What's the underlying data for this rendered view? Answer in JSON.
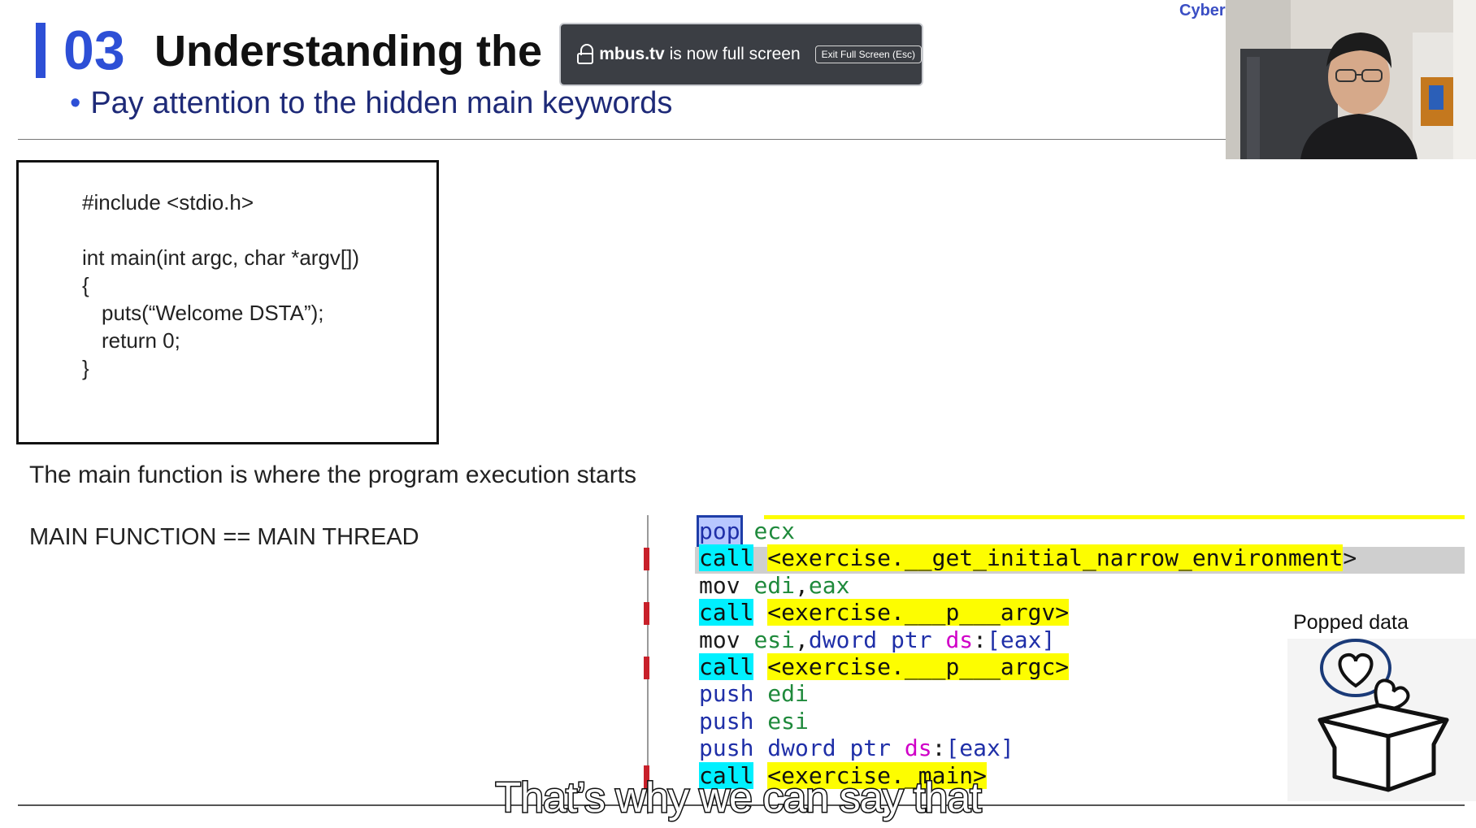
{
  "slide": {
    "number": "03",
    "title": "Understanding the",
    "subtitle": "Pay attention to the hidden main keywords",
    "brand": "Cyber"
  },
  "fullscreen_notice": {
    "domain": "mbus.tv",
    "message": " is now full screen",
    "exit_label": "Exit Full Screen (Esc)"
  },
  "code_box": {
    "lines": [
      "#include <stdio.h>",
      "int main(int argc, char *argv[])",
      "{",
      "puts(“Welcome DSTA”);",
      "return 0;",
      "}"
    ]
  },
  "description": "The main function is where the program  execution starts",
  "main_equivalence": "MAIN FUNCTION  == MAIN THREAD",
  "disassembly": {
    "lines": [
      {
        "op": "pop",
        "args": [
          {
            "t": "reg",
            "v": "ecx"
          }
        ]
      },
      {
        "op": "call",
        "args": [
          {
            "t": "target",
            "v": "<exercise.__get_initial_narrow_environment"
          },
          {
            "t": "plain",
            "v": ">"
          }
        ]
      },
      {
        "op": "mov",
        "args": [
          {
            "t": "reg",
            "v": "edi"
          },
          {
            "t": "plain",
            "v": ","
          },
          {
            "t": "reg",
            "v": "eax"
          }
        ]
      },
      {
        "op": "call",
        "args": [
          {
            "t": "target",
            "v": "<exercise.___p___argv>"
          }
        ]
      },
      {
        "op": "mov",
        "args": [
          {
            "t": "reg",
            "v": "esi"
          },
          {
            "t": "plain",
            "v": ","
          },
          {
            "t": "kw",
            "v": "dword ptr "
          },
          {
            "t": "seg",
            "v": "ds"
          },
          {
            "t": "plain",
            "v": ":"
          },
          {
            "t": "brk",
            "v": "[eax]"
          }
        ]
      },
      {
        "op": "call",
        "args": [
          {
            "t": "target",
            "v": "<exercise.___p___argc>"
          }
        ]
      },
      {
        "op": "push",
        "args": [
          {
            "t": "reg",
            "v": "edi"
          }
        ]
      },
      {
        "op": "push",
        "args": [
          {
            "t": "reg",
            "v": "esi"
          }
        ]
      },
      {
        "op": "push",
        "args": [
          {
            "t": "kw",
            "v": "dword ptr "
          },
          {
            "t": "seg",
            "v": "ds"
          },
          {
            "t": "plain",
            "v": ":"
          },
          {
            "t": "brk",
            "v": "[eax]"
          }
        ]
      },
      {
        "op": "call",
        "args": [
          {
            "t": "target",
            "v": "<exercise._main>"
          }
        ]
      }
    ]
  },
  "popped_data": {
    "label": "Popped data",
    "icon": "box-with-hearts-icon"
  },
  "caption": "That’s why we can say that",
  "colors": {
    "accent": "#2d4fd6",
    "call_highlight": "#00f0ff",
    "target_highlight": "#fdfd00",
    "register": "#1f8a3c",
    "segment": "#d000c8",
    "breakpoint": "#c8202a"
  }
}
